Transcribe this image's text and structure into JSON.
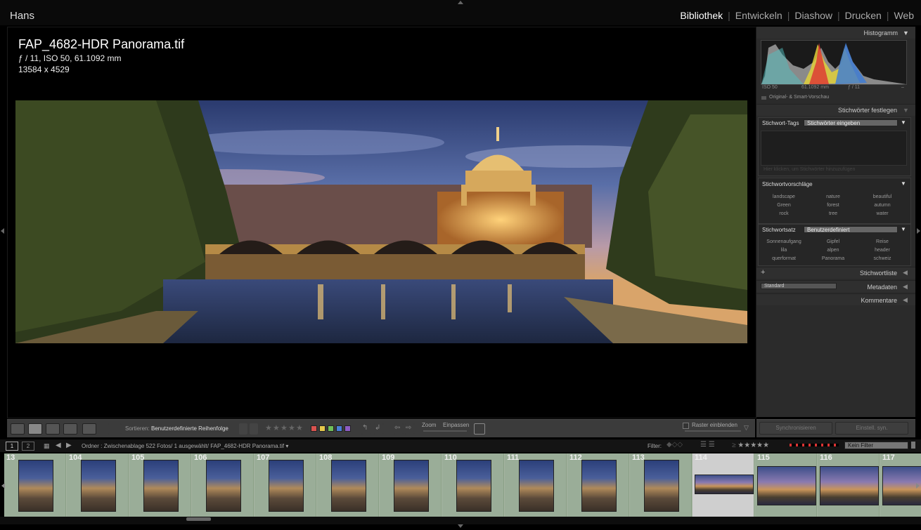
{
  "user": "Hans",
  "modules": [
    {
      "label": "Bibliothek",
      "active": true
    },
    {
      "label": "Entwickeln",
      "active": false
    },
    {
      "label": "Diashow",
      "active": false
    },
    {
      "label": "Drucken",
      "active": false
    },
    {
      "label": "Web",
      "active": false
    }
  ],
  "photo_info": {
    "filename": "FAP_4682-HDR Panorama.tif",
    "exposure": "ƒ / 11, ISO 50, 61.1092 mm",
    "dimensions": "13584 x 4529"
  },
  "toolbar": {
    "sort_label": "Sortieren:",
    "sort_value": "Benutzerdefinierte Reihenfolge",
    "zoom_label": "Zoom",
    "fit_label": "Einpassen",
    "raster_label": "Raster einblenden",
    "color_labels": [
      "#d9534f",
      "#e6c84b",
      "#6fbf5a",
      "#4a7fd6",
      "#8d5cc4"
    ]
  },
  "histogram": {
    "title": "Histogramm",
    "iso": "ISO 50",
    "focal": "61.1092 mm",
    "aperture": "ƒ / 11",
    "extra": "–",
    "preview": "Original- & Smart-Vorschau"
  },
  "keyword_panel": {
    "title": "Stichwörter festlegen",
    "tags_label": "Stichwort-Tags",
    "tags_value": "Stichwörter eingeben",
    "hint": "Hier klicken, um Stichwörter hinzuzufügen",
    "suggestions_label": "Stichwortvorschläge",
    "suggestions": [
      "landscape",
      "nature",
      "beautiful",
      "Green",
      "forest",
      "autumn",
      "rock",
      "tree",
      "water"
    ],
    "set_label": "Stichwortsatz",
    "set_value": "Benutzerdefiniert",
    "set_items": [
      "Sonnenaufgang",
      "Gipfel",
      "Reise",
      "lila",
      "alpen",
      "header",
      "querformat",
      "Panorama",
      "schweiz"
    ]
  },
  "keyword_list": {
    "plus": "+",
    "title": "Stichwortliste"
  },
  "metadata": {
    "preset": "Standard",
    "title": "Metadaten"
  },
  "comments": {
    "title": "Kommentare"
  },
  "sync": {
    "sync_meta": "Synchronisieren",
    "sync_settings": "Einstell. syn."
  },
  "filmstrip_header": {
    "view1": "1",
    "view2": "2",
    "path": "Ordner : Zwischenablage   522 Fotos/  1 ausgewählt/  FAP_4682-HDR Panorama.tif ▾",
    "filter_label": "Filter:",
    "filter_value": "Kein Filter"
  },
  "filmstrip": [
    {
      "num": "13"
    },
    {
      "num": "104"
    },
    {
      "num": "105"
    },
    {
      "num": "106"
    },
    {
      "num": "107"
    },
    {
      "num": "108"
    },
    {
      "num": "109"
    },
    {
      "num": "110"
    },
    {
      "num": "111"
    },
    {
      "num": "112"
    },
    {
      "num": "113"
    },
    {
      "num": "114"
    },
    {
      "num": "115"
    },
    {
      "num": "116"
    },
    {
      "num": "117"
    }
  ]
}
